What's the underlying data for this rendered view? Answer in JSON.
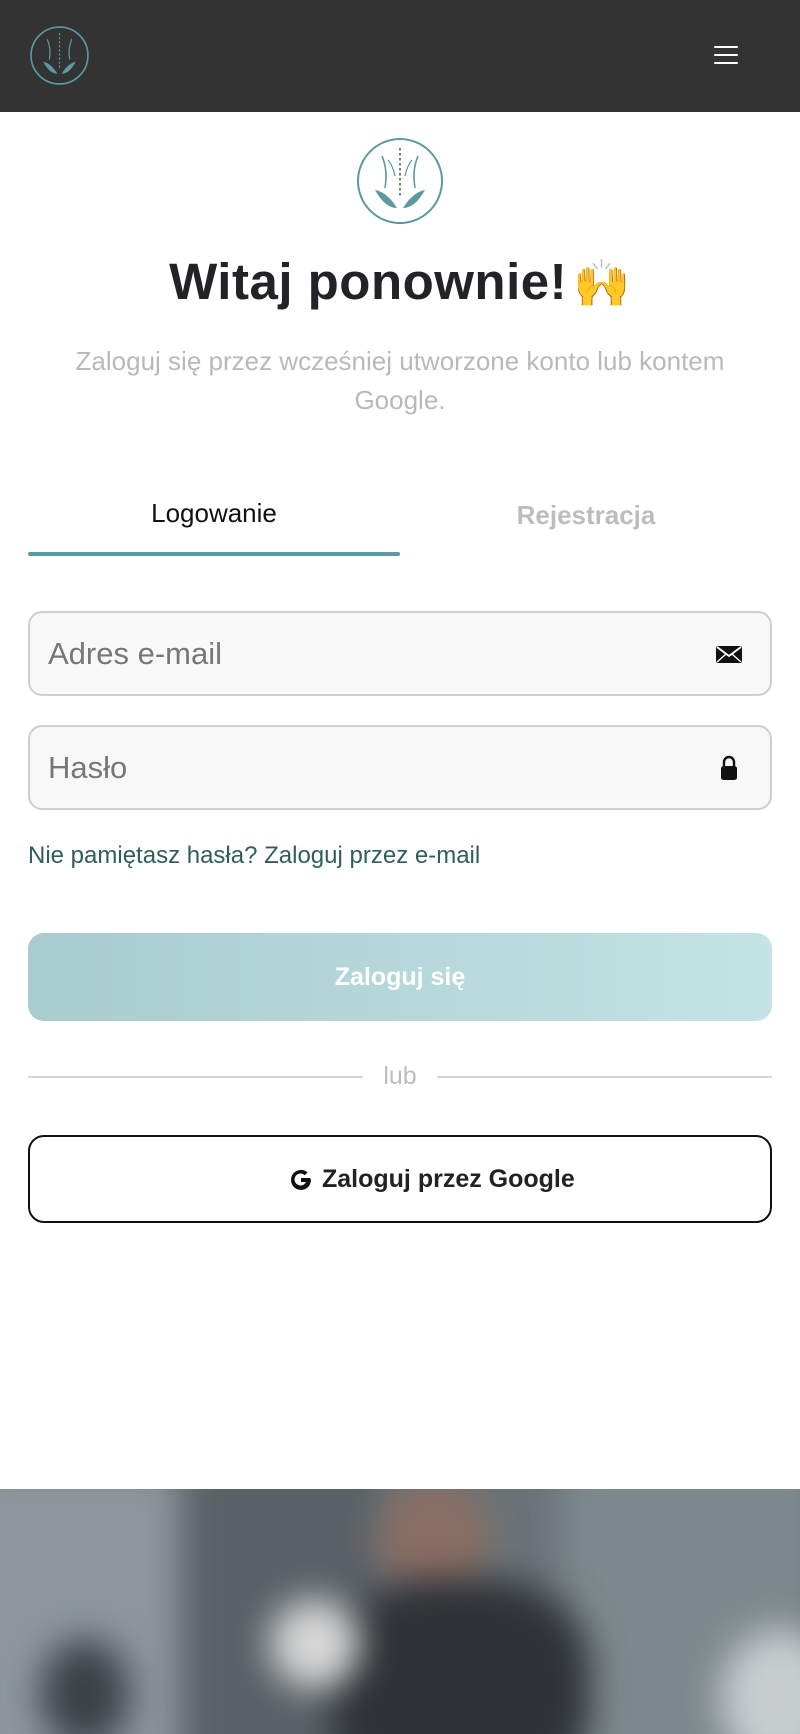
{
  "header": {
    "logo_icon": "spine-hands-logo-icon",
    "menu_icon": "hamburger-menu-icon"
  },
  "main": {
    "logo_icon": "spine-hands-logo-icon",
    "title": "Witaj ponownie!",
    "title_emoji": "🙌",
    "subtitle": "Zaloguj się przez wcześniej utworzone konto lub kontem Google."
  },
  "tabs": {
    "login": "Logowanie",
    "register": "Rejestracja",
    "active": "login"
  },
  "form": {
    "email_placeholder": "Adres e-mail",
    "email_value": "",
    "email_icon": "envelope-icon",
    "password_placeholder": "Hasło",
    "password_value": "",
    "password_icon": "lock-icon",
    "forgot_link": "Nie pamiętasz hasła? Zaloguj przez e-mail",
    "submit_label": "Zaloguj się",
    "divider_text": "lub",
    "google_label": "Zaloguj przez Google",
    "google_icon": "google-g-icon"
  },
  "colors": {
    "topbar": "#333333",
    "accent": "#5a9aa0",
    "link": "#2f5e5c",
    "submit_gradient_start": "#a9ccd0",
    "submit_gradient_end": "#c3e3e4"
  },
  "footer": {
    "hero_image": "blurred-photo-of-man-in-gym"
  }
}
